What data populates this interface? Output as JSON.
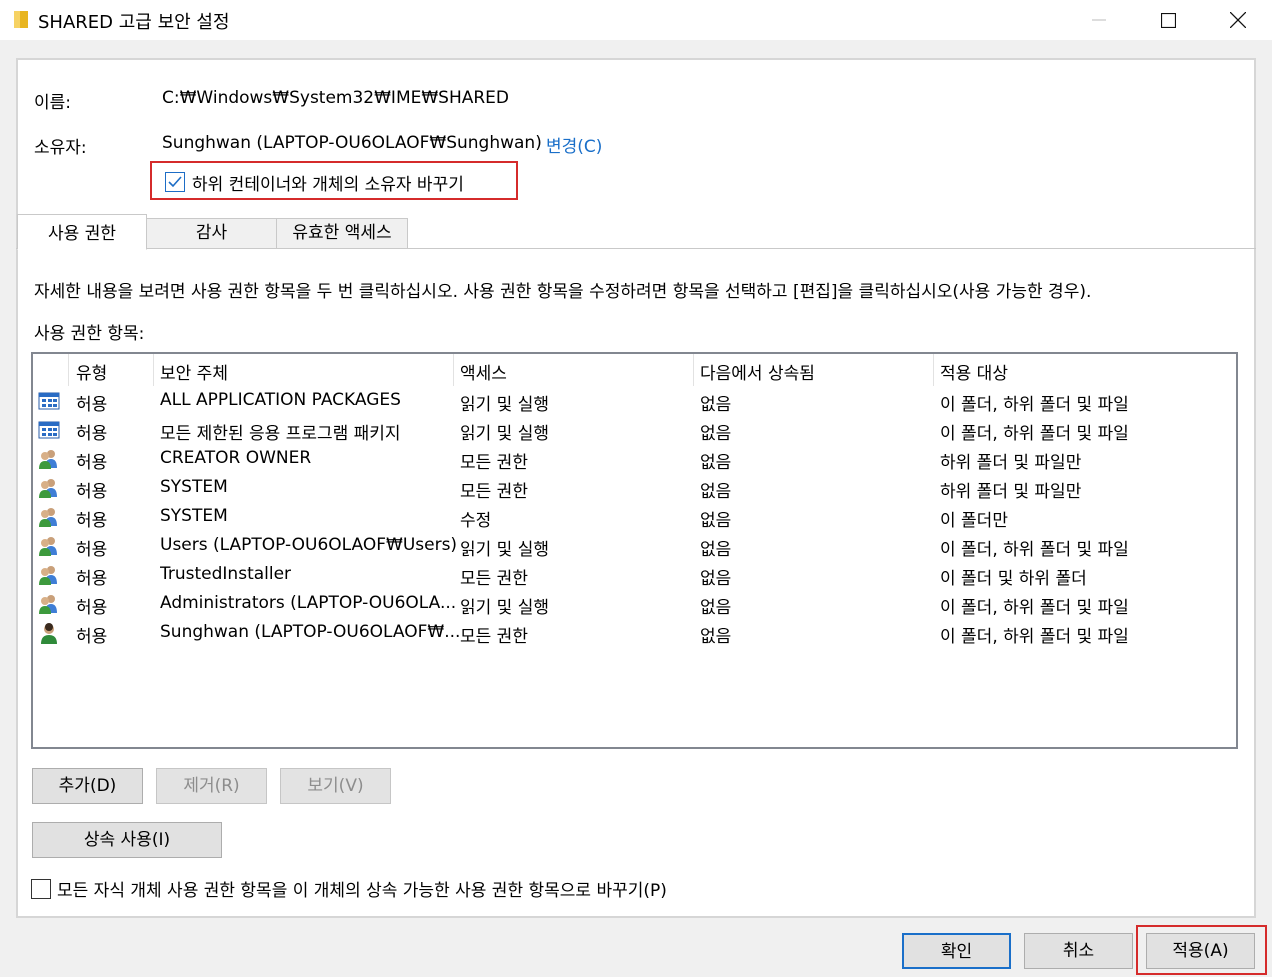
{
  "window": {
    "title": "SHARED 고급 보안 설정",
    "minimize_icon": "minimize-icon",
    "maximize_icon": "maximize-icon",
    "close_icon": "close-icon"
  },
  "info": {
    "name_label": "이름:",
    "name_value": "C:₩Windows₩System32₩IME₩SHARED",
    "owner_label": "소유자:",
    "owner_value": "Sunghwan (LAPTOP-OU6OLAOF₩Sunghwan)",
    "change_link": "변경(C)",
    "replace_owner_label": "하위 컨테이너와 개체의 소유자 바꾸기",
    "replace_owner_checked": true
  },
  "tabs": [
    {
      "label": "사용 권한",
      "active": true
    },
    {
      "label": "감사",
      "active": false
    },
    {
      "label": "유효한 액세스",
      "active": false
    }
  ],
  "description": "자세한 내용을 보려면 사용 권한 항목을 두 번 클릭하십시오. 사용 권한 항목을 수정하려면 항목을 선택하고 [편집]을 클릭하십시오(사용 가능한 경우).",
  "list_title": "사용 권한 항목:",
  "columns": [
    "유형",
    "보안 주체",
    "액세스",
    "다음에서 상속됨",
    "적용 대상"
  ],
  "entries": [
    {
      "icon": "app-packages-icon",
      "type": "허용",
      "principal": "ALL APPLICATION PACKAGES",
      "access": "읽기 및 실행",
      "inherited": "없음",
      "applies": "이 폴더, 하위 폴더 및 파일"
    },
    {
      "icon": "app-packages-icon",
      "type": "허용",
      "principal": "모든 제한된 응용 프로그램 패키지",
      "access": "읽기 및 실행",
      "inherited": "없음",
      "applies": "이 폴더, 하위 폴더 및 파일"
    },
    {
      "icon": "group-icon",
      "type": "허용",
      "principal": "CREATOR OWNER",
      "access": "모든 권한",
      "inherited": "없음",
      "applies": "하위 폴더 및 파일만"
    },
    {
      "icon": "group-icon",
      "type": "허용",
      "principal": "SYSTEM",
      "access": "모든 권한",
      "inherited": "없음",
      "applies": "하위 폴더 및 파일만"
    },
    {
      "icon": "group-icon",
      "type": "허용",
      "principal": "SYSTEM",
      "access": "수정",
      "inherited": "없음",
      "applies": "이 폴더만"
    },
    {
      "icon": "group-icon",
      "type": "허용",
      "principal": "Users (LAPTOP-OU6OLAOF₩Users)",
      "access": "읽기 및 실행",
      "inherited": "없음",
      "applies": "이 폴더, 하위 폴더 및 파일"
    },
    {
      "icon": "group-icon",
      "type": "허용",
      "principal": "TrustedInstaller",
      "access": "모든 권한",
      "inherited": "없음",
      "applies": "이 폴더 및 하위 폴더"
    },
    {
      "icon": "group-icon",
      "type": "허용",
      "principal": "Administrators (LAPTOP-OU6OLA...",
      "access": "읽기 및 실행",
      "inherited": "없음",
      "applies": "이 폴더, 하위 폴더 및 파일"
    },
    {
      "icon": "user-icon",
      "type": "허용",
      "principal": "Sunghwan (LAPTOP-OU6OLAOF₩...",
      "access": "모든 권한",
      "inherited": "없음",
      "applies": "이 폴더, 하위 폴더 및 파일"
    }
  ],
  "buttons": {
    "add": "추가(D)",
    "remove": "제거(R)",
    "view": "보기(V)",
    "inherit": "상속 사용(I)",
    "ok": "확인",
    "cancel": "취소",
    "apply": "적용(A)"
  },
  "replace_child": {
    "label": "모든 자식 개체 사용 권한 항목을 이 개체의 상속 가능한 사용 권한 항목으로 바꾸기(P)",
    "checked": false
  },
  "colors": {
    "accent": "#1a6fc9",
    "highlight": "#d52b2b"
  }
}
